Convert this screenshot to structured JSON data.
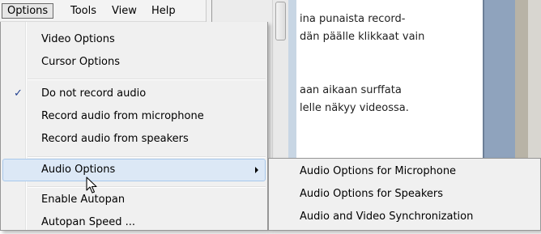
{
  "menubar": {
    "items": [
      {
        "label": "Options",
        "active": true
      },
      {
        "label": "Tools"
      },
      {
        "label": "View"
      },
      {
        "label": "Help"
      }
    ]
  },
  "menu": {
    "items": [
      {
        "label": "Video Options"
      },
      {
        "label": "Cursor Options"
      },
      {
        "label": "Do not record audio",
        "checked": true
      },
      {
        "label": "Record audio from microphone"
      },
      {
        "label": "Record audio from speakers"
      },
      {
        "label": "Audio Options",
        "highlighted": true,
        "has_submenu": true
      },
      {
        "label": "Enable Autopan"
      },
      {
        "label": "Autopan Speed ..."
      }
    ],
    "check_glyph": "✓"
  },
  "submenu": {
    "items": [
      {
        "label": "Audio Options for Microphone"
      },
      {
        "label": "Audio Options for Speakers"
      },
      {
        "label": "Audio and  Video Synchronization"
      }
    ]
  },
  "document": {
    "lines": [
      "ina punaista record-",
      "dän päälle klikkaat vain",
      "aan aikaan surffata",
      "lelle näkyy videossa."
    ]
  },
  "colors": {
    "menu_background": "#f0f0f0",
    "highlight_background": "#dce8f6",
    "highlight_border": "#a8c8eb",
    "check_color": "#1f3f8f"
  }
}
